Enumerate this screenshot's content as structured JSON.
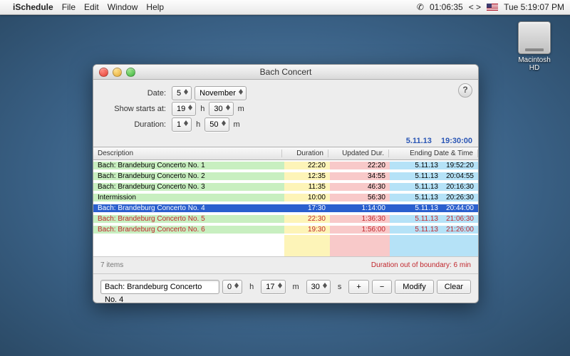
{
  "menubar": {
    "app": "iSchedule",
    "items": [
      "File",
      "Edit",
      "Window",
      "Help"
    ],
    "phone_time": "01:06:35",
    "clock": "Tue 5:19:07 PM"
  },
  "desktop": {
    "drive_label": "Macintosh HD"
  },
  "window": {
    "title": "Bach Concert",
    "help": "?",
    "form": {
      "date_label": "Date:",
      "day": "5",
      "month": "November",
      "starts_label": "Show starts at:",
      "start_h": "19",
      "start_m": "30",
      "duration_label": "Duration:",
      "dur_h": "1",
      "dur_m": "50",
      "h": "h",
      "m": "m"
    },
    "header_date": "5.11.13",
    "header_time": "19:30:00",
    "columns": {
      "desc": "Description",
      "dur": "Duration",
      "upd": "Updated Dur.",
      "end": "Ending Date & Time"
    },
    "rows": [
      {
        "desc": "Bach: Brandeburg Concerto No. 1",
        "dur": "22:20",
        "upd": "22:20",
        "ed": "5.11.13",
        "et": "19:52:20",
        "sel": false,
        "over": false
      },
      {
        "desc": "Bach: Brandeburg Concerto No. 2",
        "dur": "12:35",
        "upd": "34:55",
        "ed": "5.11.13",
        "et": "20:04:55",
        "sel": false,
        "over": false
      },
      {
        "desc": "Bach: Brandeburg Concerto No. 3",
        "dur": "11:35",
        "upd": "46:30",
        "ed": "5.11.13",
        "et": "20:16:30",
        "sel": false,
        "over": false
      },
      {
        "desc": "Intermission",
        "dur": "10:00",
        "upd": "56:30",
        "ed": "5.11.13",
        "et": "20:26:30",
        "sel": false,
        "over": false
      },
      {
        "desc": "Bach: Brandeburg Concerto No. 4",
        "dur": "17:30",
        "upd": "1:14:00",
        "ed": "5.11.13",
        "et": "20:44:00",
        "sel": true,
        "over": false
      },
      {
        "desc": "Bach: Brandeburg Concerto No. 5",
        "dur": "22:30",
        "upd": "1:36:30",
        "ed": "5.11.13",
        "et": "21:06:30",
        "sel": false,
        "over": true
      },
      {
        "desc": "Bach: Brandeburg Concerto No. 6",
        "dur": "19:30",
        "upd": "1:56:00",
        "ed": "5.11.13",
        "et": "21:26:00",
        "sel": false,
        "over": true
      }
    ],
    "status_left": "7 items",
    "status_right": "Duration out of boundary: 6 min",
    "editor": {
      "text": "Bach: Brandeburg Concerto No. 4",
      "h": "0",
      "m": "17",
      "s": "30",
      "h_u": "h",
      "m_u": "m",
      "s_u": "s",
      "plus": "+",
      "minus": "−",
      "modify": "Modify",
      "clear": "Clear"
    }
  }
}
